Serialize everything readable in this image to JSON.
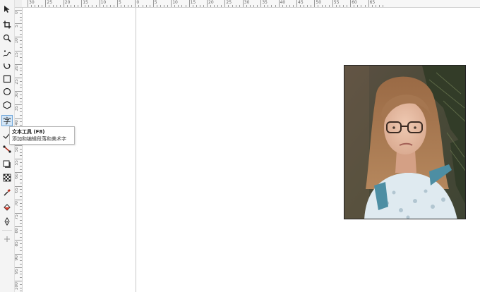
{
  "toolbar": {
    "tools": [
      {
        "name": "pick-tool",
        "icon": "pointer-icon"
      },
      {
        "name": "crop-tool",
        "icon": "crop-icon"
      },
      {
        "name": "zoom-tool",
        "icon": "magnifier-icon"
      },
      {
        "name": "freehand-tool",
        "icon": "freehand-icon"
      },
      {
        "name": "artistic-media-tool",
        "icon": "curve-icon"
      },
      {
        "name": "rectangle-tool",
        "icon": "rectangle-icon"
      },
      {
        "name": "ellipse-tool",
        "icon": "ellipse-icon"
      },
      {
        "name": "polygon-tool",
        "icon": "polygon-icon"
      },
      {
        "name": "text-tool",
        "icon": "text-icon",
        "glyph": "字",
        "active": true
      },
      {
        "name": "parallel-dimension-tool",
        "icon": "dimension-icon"
      },
      {
        "name": "connector-tool",
        "icon": "connector-icon"
      },
      {
        "name": "drop-shadow-tool",
        "icon": "shadow-icon"
      },
      {
        "name": "transparency-tool",
        "icon": "checker-icon"
      },
      {
        "name": "eyedropper-tool",
        "icon": "eyedropper-icon"
      },
      {
        "name": "interactive-fill-tool",
        "icon": "fill-bucket-icon"
      },
      {
        "name": "smart-fill-tool",
        "icon": "pen-nib-icon"
      },
      {
        "name": "add-tool-button",
        "icon": "plus-icon"
      }
    ]
  },
  "tooltip": {
    "title": "文本工具 (F8)",
    "description": "添加和编辑段落和美术字"
  },
  "rulers": {
    "horizontal_labels": [
      "30",
      "25",
      "20",
      "15",
      "10",
      "5",
      "0",
      "5",
      "10",
      "15",
      "20",
      "25",
      "30",
      "35",
      "40",
      "45",
      "50",
      "55",
      "60",
      "65"
    ],
    "vertical_labels": [
      "0",
      "5",
      "10",
      "15",
      "20",
      "25",
      "30",
      "35",
      "40",
      "45",
      "50",
      "55",
      "60",
      "65",
      "70",
      "75",
      "80",
      "85",
      "90",
      "95",
      "100"
    ]
  },
  "canvas": {
    "image": {
      "name": "portrait-photo",
      "description_icon": "photo-image"
    }
  },
  "colors": {
    "accent": "#d3e6f7",
    "accent_border": "#6aa3d8",
    "toolbar_bg": "#f4f4f4",
    "ruler_bg": "#f7f7f7"
  }
}
